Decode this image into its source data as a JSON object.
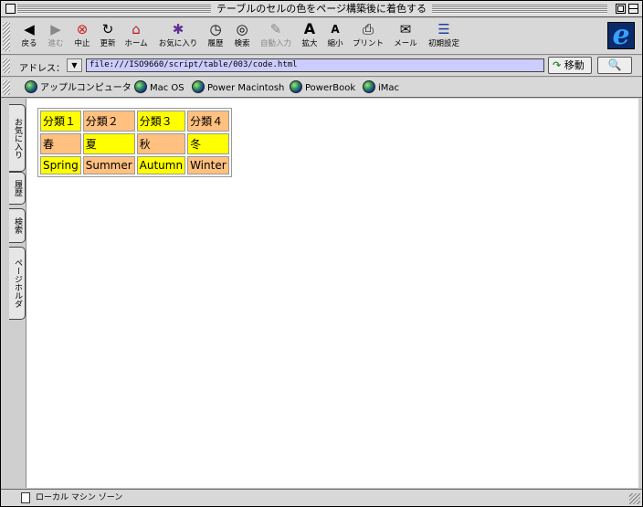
{
  "window": {
    "title": "テーブルのセルの色をページ構築後に着色する"
  },
  "toolbar": {
    "buttons": [
      {
        "label": "戻る",
        "icon": "◀",
        "disabled": false
      },
      {
        "label": "進む",
        "icon": "▶",
        "disabled": true
      },
      {
        "label": "中止",
        "icon": "⊗",
        "disabled": false
      },
      {
        "label": "更新",
        "icon": "↻",
        "disabled": false
      },
      {
        "label": "ホーム",
        "icon": "⌂",
        "disabled": false
      },
      {
        "label": "お気に入り",
        "icon": "✱",
        "disabled": false
      },
      {
        "label": "履歴",
        "icon": "◷",
        "disabled": false
      },
      {
        "label": "検索",
        "icon": "◎",
        "disabled": false
      },
      {
        "label": "自動入力",
        "icon": "✎",
        "disabled": true
      },
      {
        "label": "拡大",
        "icon": "A",
        "disabled": false
      },
      {
        "label": "縮小",
        "icon": "A",
        "disabled": false
      },
      {
        "label": "プリント",
        "icon": "⎙",
        "disabled": false
      },
      {
        "label": "メール",
        "icon": "✉",
        "disabled": false
      },
      {
        "label": "初期設定",
        "icon": "☰",
        "disabled": false
      }
    ]
  },
  "address": {
    "label": "アドレス：",
    "url": "file:///ISO9660/script/table/003/code.html",
    "go_label": "移動",
    "go_icon": "↷",
    "search_icon": "🔍"
  },
  "favorites": [
    "アップルコンピュータ",
    "Mac OS",
    "Power Macintosh",
    "PowerBook",
    "iMac"
  ],
  "side_tabs": [
    "お気に入り",
    "履歴",
    "検索",
    "ページホルダ"
  ],
  "table": {
    "rows": [
      [
        {
          "text": "分類１",
          "color": "#ffff00"
        },
        {
          "text": "分類２",
          "color": "#ffc080"
        },
        {
          "text": "分類３",
          "color": "#ffff00"
        },
        {
          "text": "分類４",
          "color": "#ffc080"
        }
      ],
      [
        {
          "text": "春",
          "color": "#ffc080"
        },
        {
          "text": "夏",
          "color": "#ffff00"
        },
        {
          "text": "秋",
          "color": "#ffc080"
        },
        {
          "text": "冬",
          "color": "#ffff00"
        }
      ],
      [
        {
          "text": "Spring",
          "color": "#ffff00"
        },
        {
          "text": "Summer",
          "color": "#ffc080"
        },
        {
          "text": "Autumn",
          "color": "#ffff00"
        },
        {
          "text": "Winter",
          "color": "#ffc080"
        }
      ]
    ]
  },
  "status": {
    "zone": "ローカル マシン ゾーン"
  }
}
